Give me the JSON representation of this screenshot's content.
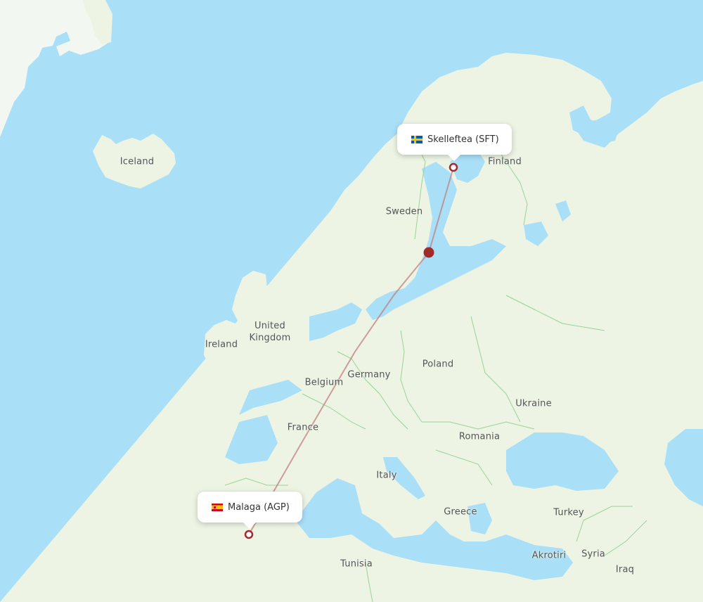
{
  "map": {
    "colors": {
      "water": "#aadff8",
      "land": "#edf4e4",
      "border": "#9bd29a",
      "route": "#c08080",
      "marker": "#a32a2a"
    },
    "route": {
      "origin": {
        "name": "Skelleftea",
        "code": "SFT",
        "label": "Skelleftea (SFT)",
        "country_flag": "sweden-flag"
      },
      "destination": {
        "name": "Malaga",
        "code": "AGP",
        "label": "Malaga (AGP)",
        "country_flag": "spain-flag"
      },
      "progress_marker": "aircraft-position-dot"
    },
    "country_labels": [
      {
        "key": "iceland",
        "text": "Iceland"
      },
      {
        "key": "finland",
        "text": "Finland"
      },
      {
        "key": "sweden",
        "text": "Sweden"
      },
      {
        "key": "united_kingdom",
        "text": "United\nKingdom"
      },
      {
        "key": "ireland",
        "text": "Ireland"
      },
      {
        "key": "belgium",
        "text": "Belgium"
      },
      {
        "key": "germany",
        "text": "Germany"
      },
      {
        "key": "poland",
        "text": "Poland"
      },
      {
        "key": "ukraine",
        "text": "Ukraine"
      },
      {
        "key": "france",
        "text": "France"
      },
      {
        "key": "romania",
        "text": "Romania"
      },
      {
        "key": "italy",
        "text": "Italy"
      },
      {
        "key": "greece",
        "text": "Greece"
      },
      {
        "key": "turkey",
        "text": "Turkey"
      },
      {
        "key": "tunisia",
        "text": "Tunisia"
      },
      {
        "key": "akrotiri",
        "text": "Akrotiri"
      },
      {
        "key": "syria",
        "text": "Syria"
      },
      {
        "key": "iraq",
        "text": "Iraq"
      }
    ]
  }
}
